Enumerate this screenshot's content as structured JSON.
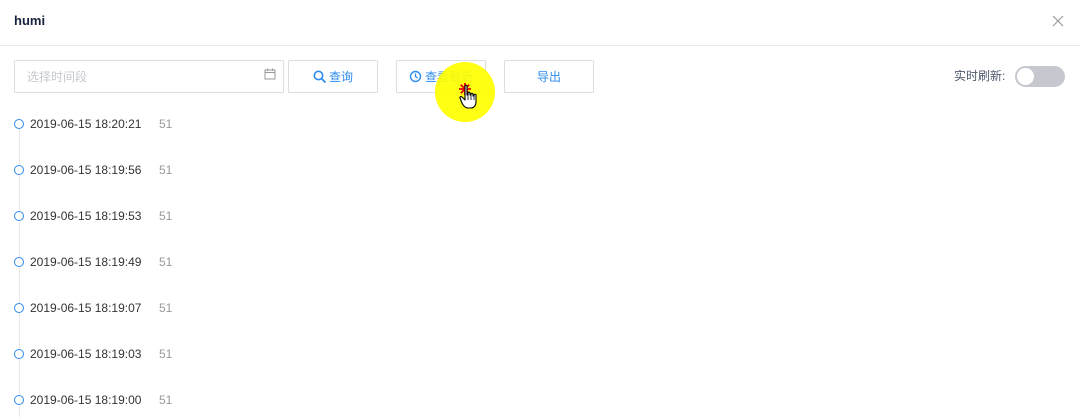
{
  "dialog": {
    "title": "humi",
    "close_icon": "close-icon"
  },
  "toolbar": {
    "date_placeholder": "选择时间段",
    "calendar_icon": "calendar-icon",
    "query_label": "查询",
    "query_icon": "search-icon",
    "latest_label": "查看最新",
    "latest_icon": "clock-refresh-icon",
    "export_label": "导出",
    "realtime_label": "实时刷新:",
    "realtime_enabled": false
  },
  "timeline": {
    "items": [
      {
        "time": "2019-06-15 18:20:21",
        "value": "51"
      },
      {
        "time": "2019-06-15 18:19:56",
        "value": "51"
      },
      {
        "time": "2019-06-15 18:19:53",
        "value": "51"
      },
      {
        "time": "2019-06-15 18:19:49",
        "value": "51"
      },
      {
        "time": "2019-06-15 18:19:07",
        "value": "51"
      },
      {
        "time": "2019-06-15 18:19:03",
        "value": "51"
      },
      {
        "time": "2019-06-15 18:19:00",
        "value": "51"
      }
    ]
  },
  "colors": {
    "accent": "#2d8cf0",
    "border": "#dcdee2",
    "cursor_highlight": "#ffff00",
    "click_marker": "#e60000"
  }
}
